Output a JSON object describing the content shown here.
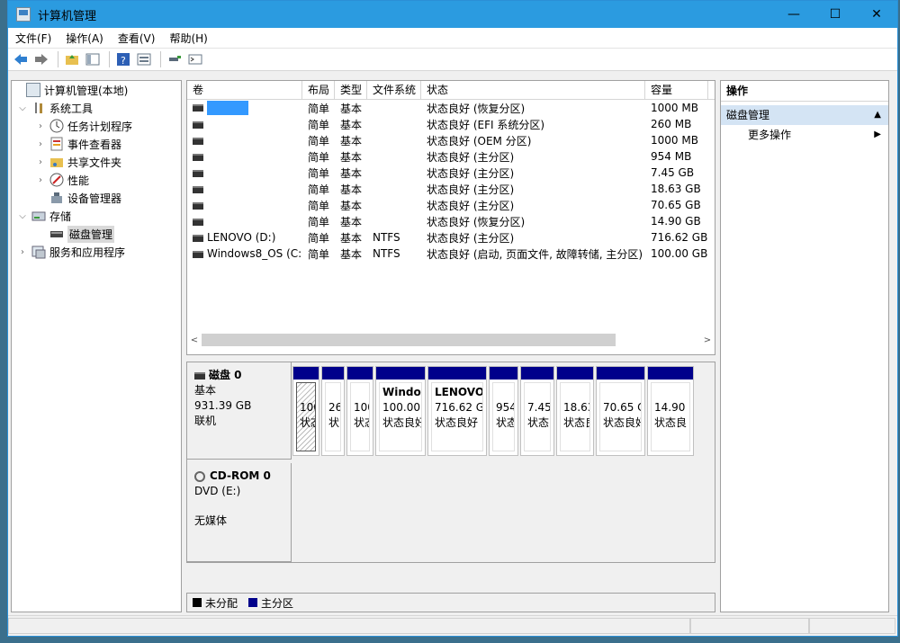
{
  "window": {
    "title": "计算机管理",
    "minimize": "—",
    "maximize": "☐",
    "close": "✕"
  },
  "menu": [
    "文件(F)",
    "操作(A)",
    "查看(V)",
    "帮助(H)"
  ],
  "tree": {
    "root": "计算机管理(本地)",
    "system_tools": "系统工具",
    "task_scheduler": "任务计划程序",
    "event_viewer": "事件查看器",
    "shared_folders": "共享文件夹",
    "performance": "性能",
    "device_manager": "设备管理器",
    "storage": "存储",
    "disk_management": "磁盘管理",
    "services_apps": "服务和应用程序"
  },
  "volume_list": {
    "headers": [
      "卷",
      "布局",
      "类型",
      "文件系统",
      "状态",
      "容量"
    ],
    "rows": [
      {
        "name": "",
        "layout": "简单",
        "type": "基本",
        "fs": "",
        "status": "状态良好 (恢复分区)",
        "capacity": "1000 MB"
      },
      {
        "name": "",
        "layout": "简单",
        "type": "基本",
        "fs": "",
        "status": "状态良好 (EFI 系统分区)",
        "capacity": "260 MB"
      },
      {
        "name": "",
        "layout": "简单",
        "type": "基本",
        "fs": "",
        "status": "状态良好 (OEM 分区)",
        "capacity": "1000 MB"
      },
      {
        "name": "",
        "layout": "简单",
        "type": "基本",
        "fs": "",
        "status": "状态良好 (主分区)",
        "capacity": "954 MB"
      },
      {
        "name": "",
        "layout": "简单",
        "type": "基本",
        "fs": "",
        "status": "状态良好 (主分区)",
        "capacity": "7.45 GB"
      },
      {
        "name": "",
        "layout": "简单",
        "type": "基本",
        "fs": "",
        "status": "状态良好 (主分区)",
        "capacity": "18.63 GB"
      },
      {
        "name": "",
        "layout": "简单",
        "type": "基本",
        "fs": "",
        "status": "状态良好 (主分区)",
        "capacity": "70.65 GB"
      },
      {
        "name": "",
        "layout": "简单",
        "type": "基本",
        "fs": "",
        "status": "状态良好 (恢复分区)",
        "capacity": "14.90 GB"
      },
      {
        "name": "LENOVO (D:)",
        "layout": "简单",
        "type": "基本",
        "fs": "NTFS",
        "status": "状态良好 (主分区)",
        "capacity": "716.62 GB"
      },
      {
        "name": "Windows8_OS (C:)",
        "layout": "简单",
        "type": "基本",
        "fs": "NTFS",
        "status": "状态良好 (启动, 页面文件, 故障转储, 主分区)",
        "capacity": "100.00 GB"
      }
    ]
  },
  "disk0": {
    "title": "磁盘 0",
    "type": "基本",
    "size": "931.39 GB",
    "state": "联机"
  },
  "disk0_parts": [
    {
      "name": "",
      "line1": "100",
      "line2": "状态"
    },
    {
      "name": "",
      "line1": "26",
      "line2": "状"
    },
    {
      "name": "",
      "line1": "100",
      "line2": "状态"
    },
    {
      "name": "Windov",
      "line1": "100.00",
      "line2": "状态良好"
    },
    {
      "name": "LENOVO",
      "line1": "716.62 GI",
      "line2": "状态良好"
    },
    {
      "name": "",
      "line1": "954",
      "line2": "状态"
    },
    {
      "name": "",
      "line1": "7.45 (",
      "line2": "状态良"
    },
    {
      "name": "",
      "line1": "18.63",
      "line2": "状态良"
    },
    {
      "name": "",
      "line1": "70.65 C",
      "line2": "状态良好"
    },
    {
      "name": "",
      "line1": "14.90 (",
      "line2": "状态良"
    }
  ],
  "cdrom": {
    "title": "CD-ROM 0",
    "drive": "DVD (E:)",
    "media": "无媒体"
  },
  "legend": {
    "unallocated": "未分配",
    "primary": "主分区"
  },
  "actions": {
    "header": "操作",
    "section": "磁盘管理",
    "more": "更多操作"
  },
  "colors": {
    "titlebar": "#2b9be0",
    "primary_partition": "#00008b",
    "selection": "#3399ff"
  }
}
